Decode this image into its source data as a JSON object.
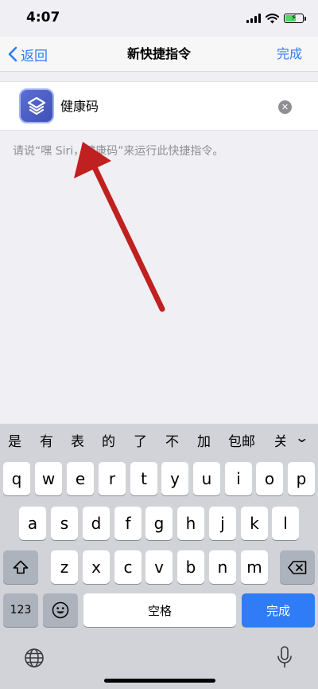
{
  "status_bar": {
    "time": "4:07"
  },
  "nav": {
    "back_label": "返回",
    "title": "新快捷指令",
    "done_label": "完成"
  },
  "shortcut": {
    "name": "健康码",
    "icon": "shortcuts-layers-icon",
    "hint": "请说“嘿 Siri，健康码”来运行此快捷指令。"
  },
  "keyboard": {
    "candidates": [
      "是",
      "有",
      "表",
      "的",
      "了",
      "不",
      "加",
      "包邮",
      "关"
    ],
    "row1": [
      "q",
      "w",
      "e",
      "r",
      "t",
      "y",
      "u",
      "i",
      "o",
      "p"
    ],
    "row2": [
      "a",
      "s",
      "d",
      "f",
      "g",
      "h",
      "j",
      "k",
      "l"
    ],
    "row3": [
      "z",
      "x",
      "c",
      "v",
      "b",
      "n",
      "m"
    ],
    "numbers_label": "123",
    "space_label": "空格",
    "return_label": "完成"
  },
  "colors": {
    "accent": "#2f7cf6",
    "annotation_arrow": "#c0201f",
    "icon_background": "#4a5bc7"
  }
}
